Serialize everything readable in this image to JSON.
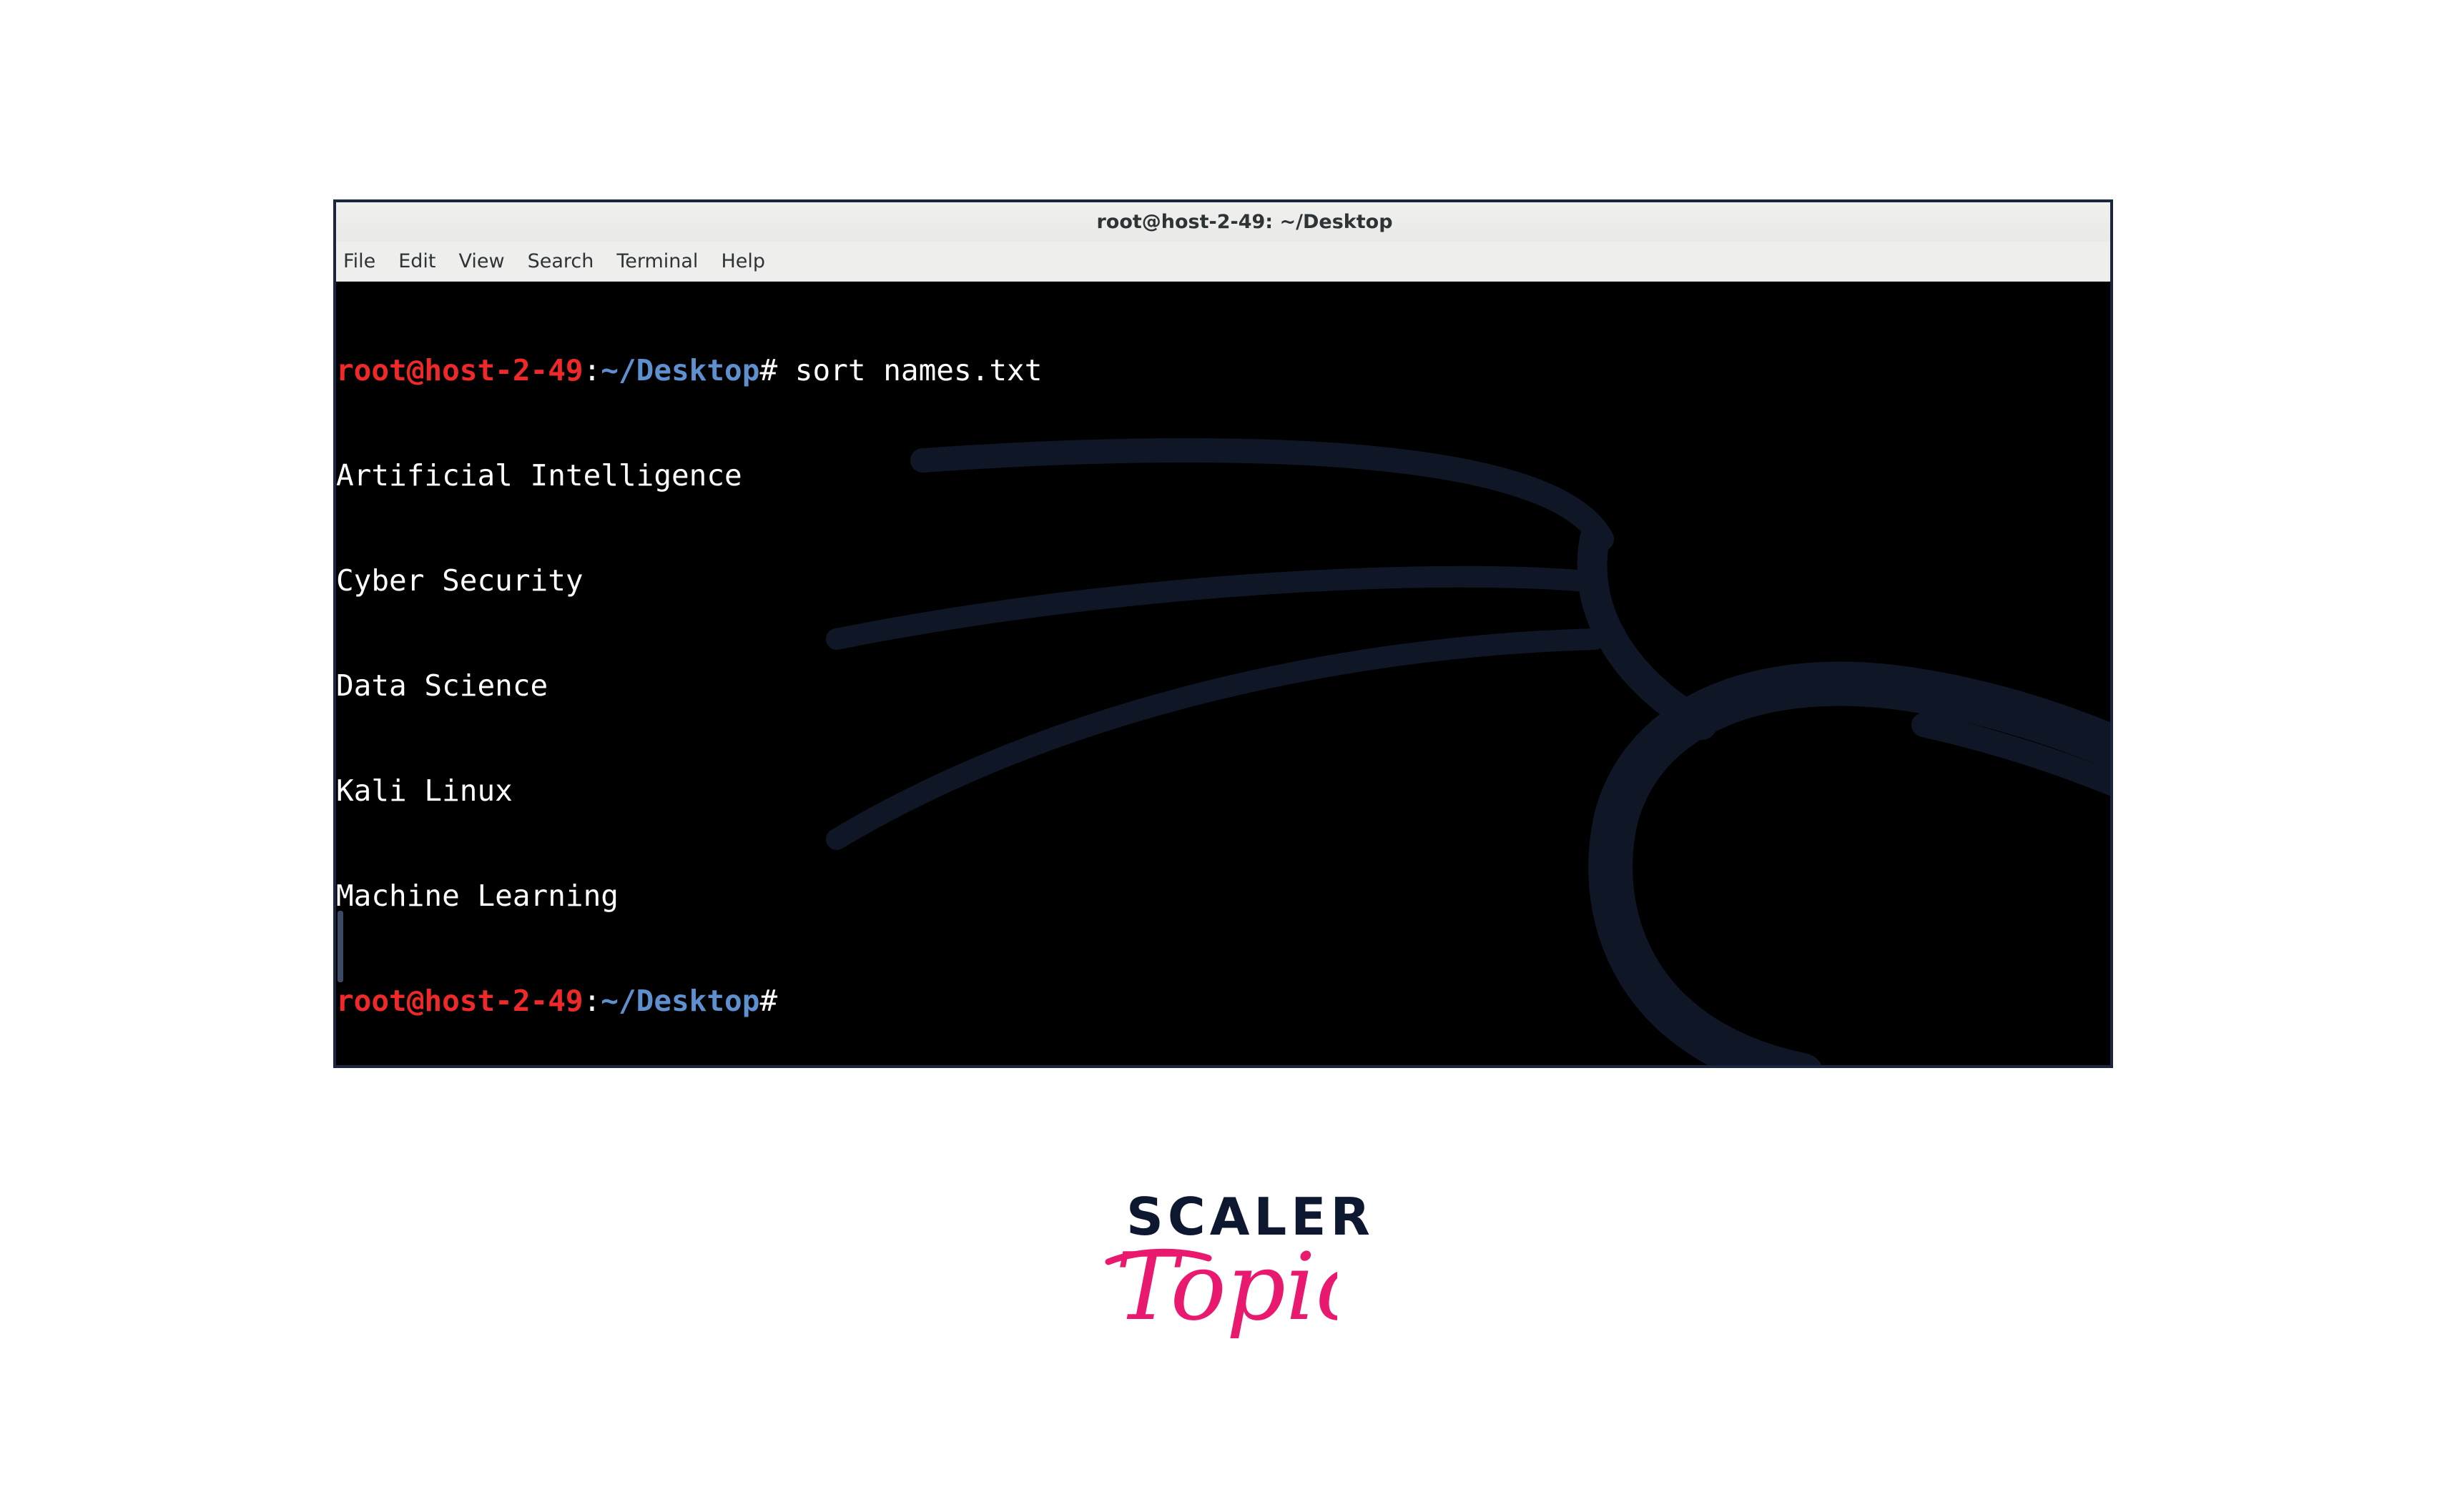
{
  "window": {
    "title": "root@host-2-49: ~/Desktop"
  },
  "menubar": {
    "items": [
      "File",
      "Edit",
      "View",
      "Search",
      "Terminal",
      "Help"
    ]
  },
  "terminal": {
    "prompt": {
      "user_host": "root@host-2-49",
      "separator": ":",
      "path": "~/Desktop",
      "hash": "#"
    },
    "command": " sort names.txt",
    "output_lines": [
      "Artificial Intelligence",
      "Cyber Security",
      "Data Science",
      "Kali Linux",
      "Machine Learning"
    ],
    "colors": {
      "background": "#000000",
      "prompt_user": "#ef2929",
      "prompt_path": "#5e8fce",
      "text": "#ffffff",
      "dragon": "#0f1726"
    }
  },
  "logo": {
    "line1": "SCALER",
    "line2": "Topics",
    "color_line1": "#0e1730",
    "color_line2": "#e8196f"
  }
}
